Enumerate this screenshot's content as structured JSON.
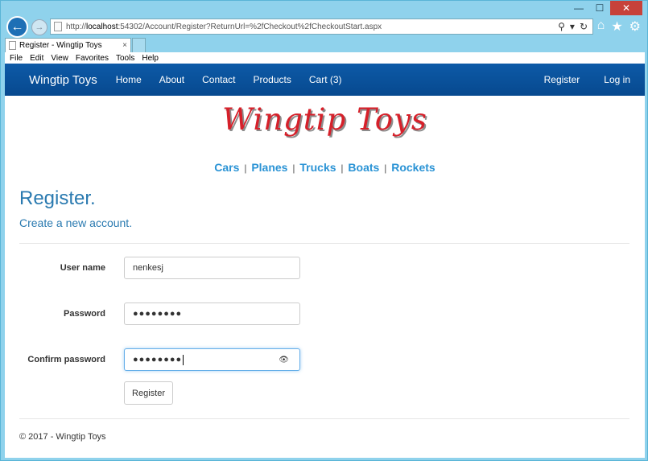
{
  "browser": {
    "url_prefix": "http://",
    "url_host": "localhost",
    "url_rest": ":54302/Account/Register?ReturnUrl=%2fCheckout%2fCheckoutStart.aspx",
    "tab_title": "Register - Wingtip Toys",
    "tab_close": "×",
    "menu": [
      "File",
      "Edit",
      "View",
      "Favorites",
      "Tools",
      "Help"
    ],
    "window_buttons": {
      "minimize": "—",
      "maximize": "☐",
      "close": "✕"
    },
    "back_glyph": "←",
    "forward_glyph": "→",
    "search_glyph": "⚲",
    "dropdown_glyph": "▾",
    "refresh_glyph": "↻",
    "home_glyph": "⌂",
    "favorites_glyph": "★",
    "tools_glyph": "⚙"
  },
  "site": {
    "brand": "Wingtip Toys",
    "nav": [
      "Home",
      "About",
      "Contact",
      "Products",
      "Cart (3)"
    ],
    "nav_right": [
      "Register",
      "Log in"
    ],
    "logo_text": "Wingtip Toys",
    "categories": [
      "Cars",
      "Planes",
      "Trucks",
      "Boats",
      "Rockets"
    ],
    "category_separator": "|"
  },
  "form": {
    "heading": "Register.",
    "subheading": "Create a new account.",
    "username_label": "User name",
    "username_value": "nenkesj",
    "password_label": "Password",
    "password_value": "●●●●●●●●",
    "confirm_label": "Confirm password",
    "confirm_value": "●●●●●●●●",
    "reveal_glyph": "👁",
    "submit_label": "Register"
  },
  "footer": {
    "text": "© 2017 - Wingtip Toys"
  },
  "colors": {
    "navbar": "#0d5aa7",
    "link": "#2a93d5",
    "heading": "#2a7ab0",
    "logo": "#d6202a"
  }
}
